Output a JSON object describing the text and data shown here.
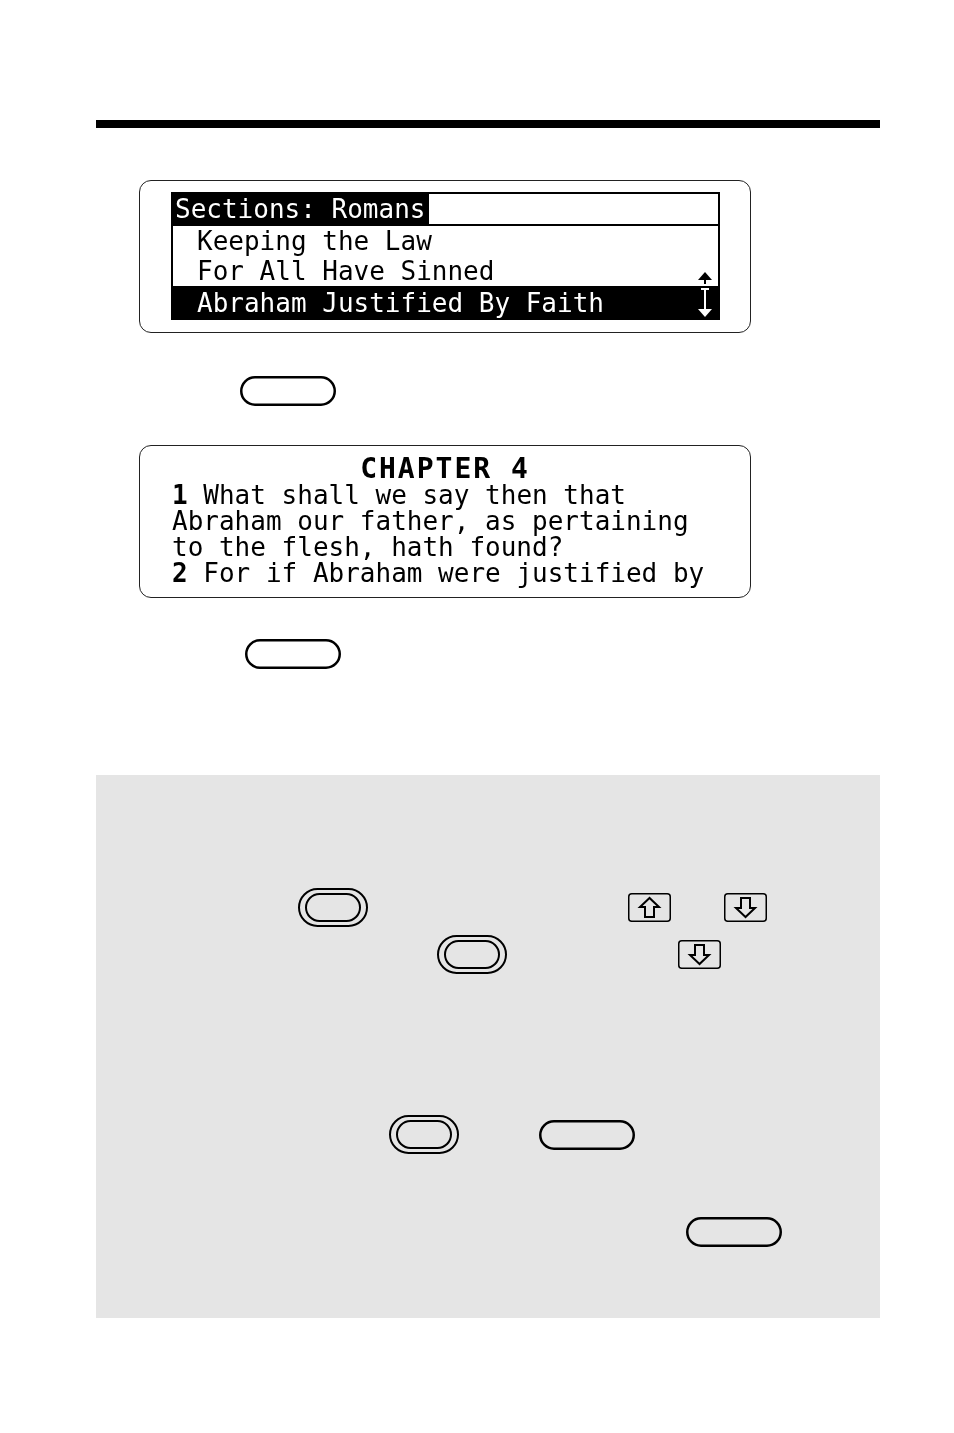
{
  "sections_screen": {
    "title": "Sections: Romans",
    "items": [
      {
        "label": "Keeping the Law",
        "selected": false
      },
      {
        "label": "For All Have Sinned",
        "selected": false
      },
      {
        "label": "Abraham Justified By Faith",
        "selected": true
      }
    ]
  },
  "chapter_screen": {
    "heading": "CHAPTER 4",
    "lines": [
      "**1** What shall we say then that",
      "Abraham our father, as pertaining",
      "to the flesh, hath found?",
      "**2** For if Abraham were justified by"
    ]
  }
}
